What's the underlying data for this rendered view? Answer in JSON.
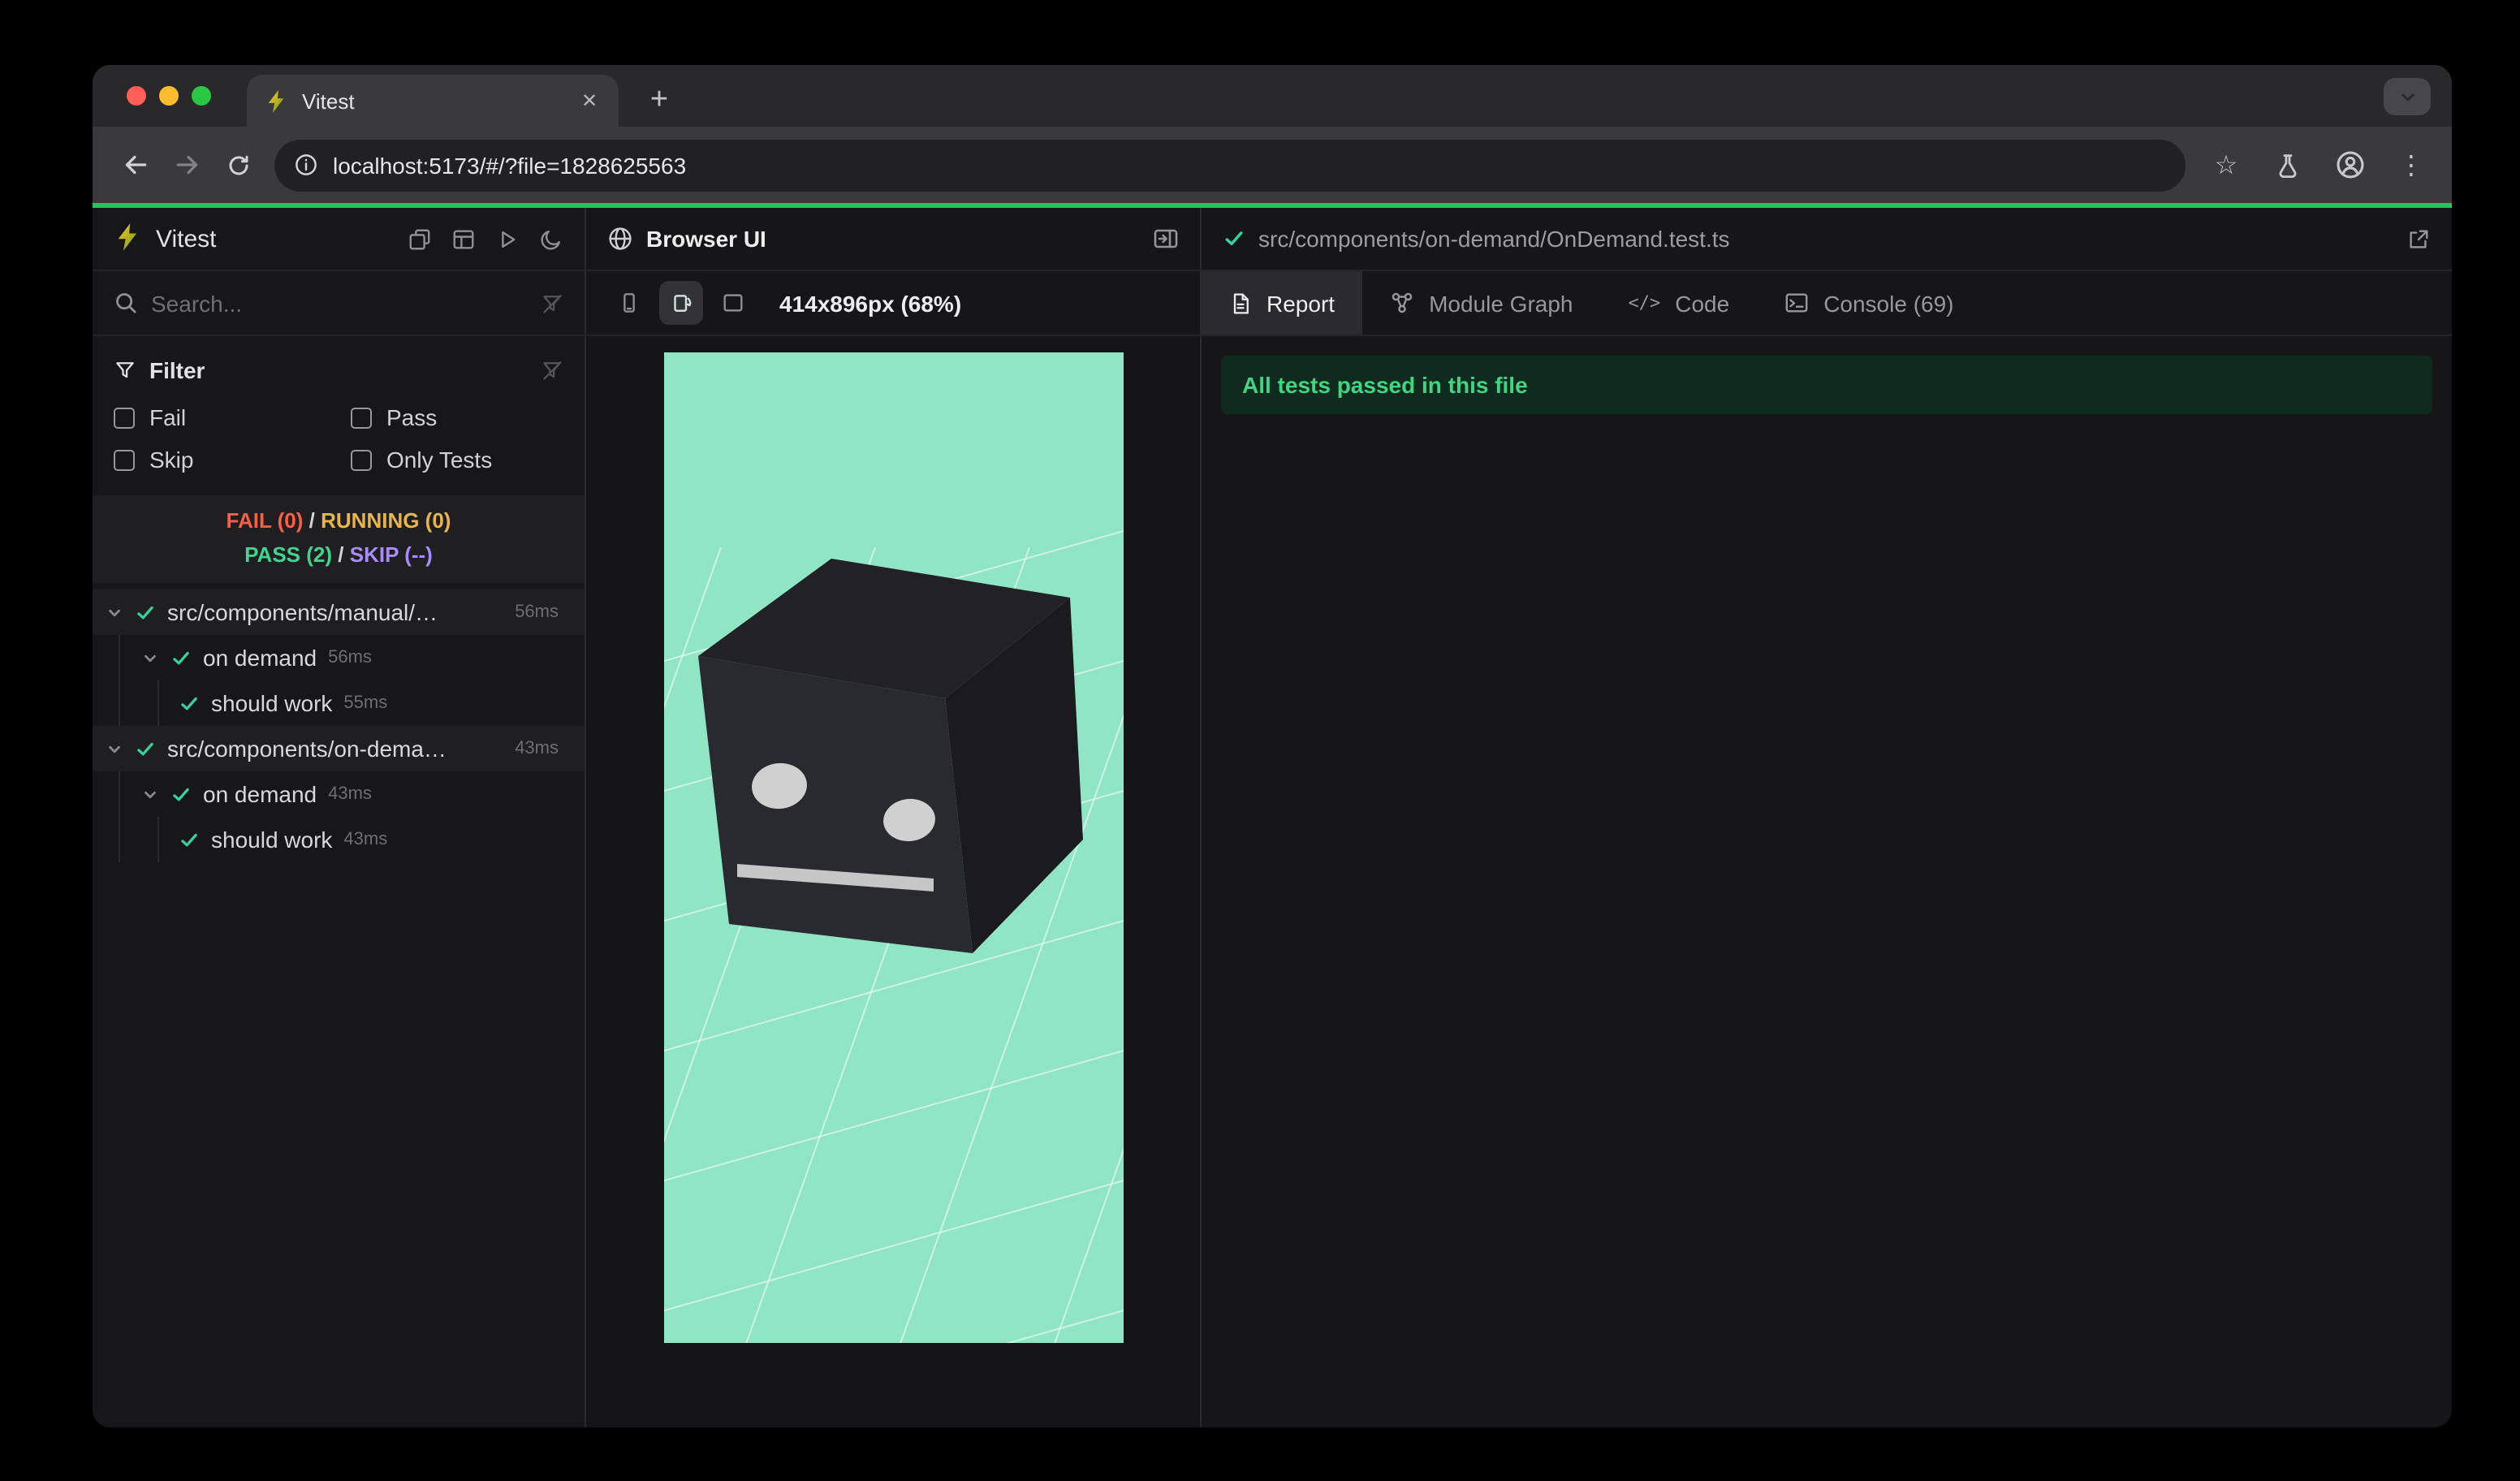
{
  "browser": {
    "tab": {
      "title": "Vitest"
    },
    "url": "localhost:5173/#/?file=1828625563"
  },
  "icons": {
    "star": "☆",
    "menu": "⋮",
    "plus": "+",
    "close": "✕",
    "code": "</>"
  },
  "vitest": {
    "brand": "Vitest",
    "search_placeholder": "Search...",
    "filter": {
      "title": "Filter",
      "options": [
        {
          "label": "Fail"
        },
        {
          "label": "Pass"
        },
        {
          "label": "Skip"
        },
        {
          "label": "Only Tests"
        }
      ]
    },
    "stats": {
      "fail": "FAIL (0)",
      "sep1": "/",
      "running": "RUNNING (0)",
      "pass": "PASS (2)",
      "sep2": "/",
      "skip": "SKIP (--)"
    },
    "tree": [
      {
        "type": "file",
        "label": "src/components/manual/…",
        "time": "56ms"
      },
      {
        "type": "suite",
        "label": "on demand",
        "time": "56ms"
      },
      {
        "type": "test",
        "label": "should work",
        "time": "55ms"
      },
      {
        "type": "file",
        "label": "src/components/on-dema…",
        "time": "43ms"
      },
      {
        "type": "suite",
        "label": "on demand",
        "time": "43ms"
      },
      {
        "type": "test",
        "label": "should work",
        "time": "43ms"
      }
    ]
  },
  "preview": {
    "title": "Browser UI",
    "size_label": "414x896px (68%)"
  },
  "report": {
    "file": "src/components/on-demand/OnDemand.test.ts",
    "tabs": [
      {
        "label": "Report"
      },
      {
        "label": "Module Graph"
      },
      {
        "label": "Code"
      },
      {
        "label": "Console (69)"
      }
    ],
    "active_tab": "Report",
    "banner": "All tests passed in this file"
  },
  "colors": {
    "accent_green_bar": "#22c55e",
    "pass_text": "#42d392",
    "fail_text": "#fa5f45",
    "running_text": "#e7b549",
    "skip_text": "#a78bfa",
    "preview_bg": "#90e5c5",
    "banner_bg": "#0f2b1d",
    "banner_text": "#43d483"
  }
}
